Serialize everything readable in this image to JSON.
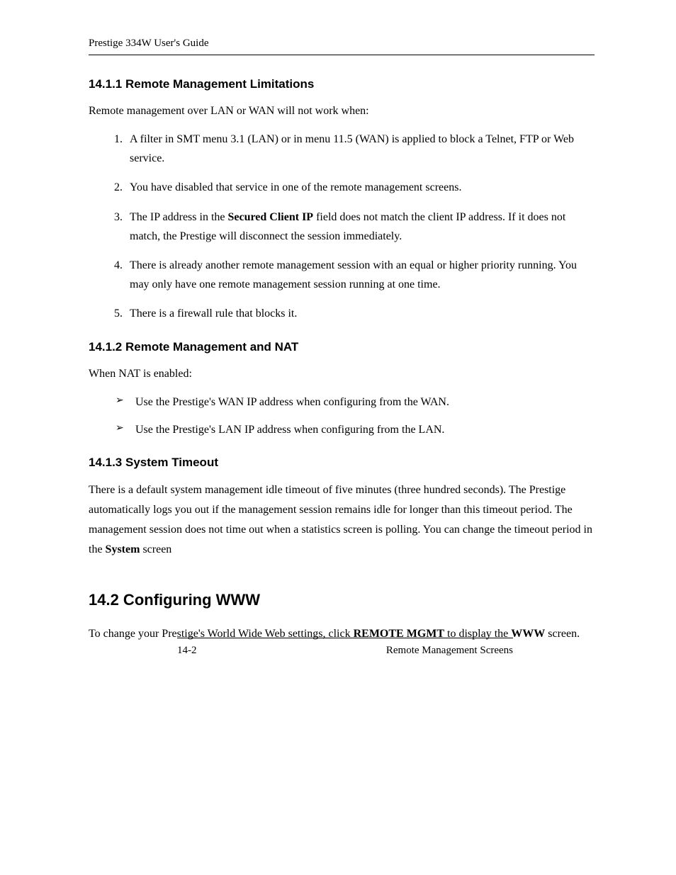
{
  "header": {
    "title": "Prestige 334W User's Guide"
  },
  "sections": {
    "s1": {
      "heading": "14.1.1 Remote Management Limitations",
      "intro": "Remote management over LAN or WAN will not work when:",
      "items": {
        "i1": "A filter in SMT menu 3.1 (LAN) or in menu 11.5 (WAN) is applied to block a Telnet, FTP or Web service.",
        "i2": "You have disabled that service in one of the remote management screens.",
        "i3a": "The IP address in the ",
        "i3b": "Secured Client IP",
        "i3c": " field does not match the client IP address. If it does not match, the Prestige will disconnect the session immediately.",
        "i4": "There is already another remote management session with an equal or higher priority running. You may only have one remote management session running at one time.",
        "i5": "There is a firewall rule that blocks it."
      }
    },
    "s2": {
      "heading": "14.1.2 Remote Management and NAT",
      "intro": "When NAT is enabled:",
      "items": {
        "b1": "Use the Prestige's WAN IP address when configuring from the WAN.",
        "b2": "Use the Prestige's LAN IP address when configuring from the LAN."
      }
    },
    "s3": {
      "heading": "14.1.3  System Timeout",
      "p1a": "There is a default system management idle timeout of five minutes (three hundred seconds). The Prestige automatically logs you out if the management session remains idle for longer than this timeout period. The management session does not time out when a statistics screen is polling. You can change the timeout period in the ",
      "p1b": "System",
      "p1c": " screen"
    },
    "s4": {
      "heading": "14.2  Configuring WWW",
      "p1a": "To change your Prestige's World Wide Web settings, click ",
      "p1b": "REMOTE MGMT",
      "p1c": " to display the ",
      "p1d": "WWW",
      "p1e": " screen."
    }
  },
  "footer": {
    "page": "14-2",
    "label": "Remote Management Screens"
  }
}
